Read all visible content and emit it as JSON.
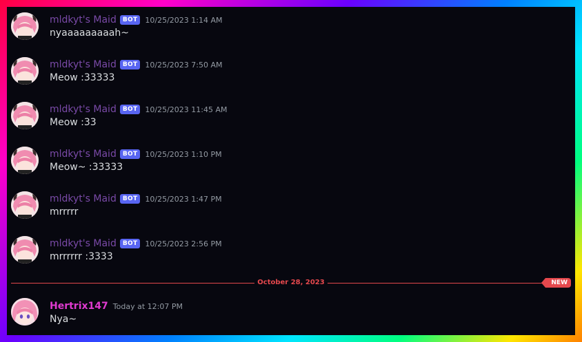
{
  "messages": [
    {
      "author": "mldkyt's Maid",
      "badge": "BOT",
      "timestamp": "10/25/2023 1:14 AM",
      "text": "nyaaaaaaaaah~"
    },
    {
      "author": "mldkyt's Maid",
      "badge": "BOT",
      "timestamp": "10/25/2023 7:50 AM",
      "text": "Meow :33333"
    },
    {
      "author": "mldkyt's Maid",
      "badge": "BOT",
      "timestamp": "10/25/2023 11:45 AM",
      "text": "Meow :33"
    },
    {
      "author": "mldkyt's Maid",
      "badge": "BOT",
      "timestamp": "10/25/2023 1:10 PM",
      "text": "Meow~ :33333"
    },
    {
      "author": "mldkyt's Maid",
      "badge": "BOT",
      "timestamp": "10/25/2023 1:47 PM",
      "text": "mrrrrr"
    },
    {
      "author": "mldkyt's Maid",
      "badge": "BOT",
      "timestamp": "10/25/2023 2:56 PM",
      "text": "mrrrrrr :3333"
    }
  ],
  "divider": {
    "date": "October 28, 2023",
    "new_label": "NEW"
  },
  "last_message": {
    "author": "Hertrix147",
    "timestamp": "Today at 12:07 PM",
    "text": "Nya~"
  },
  "colors": {
    "bot_name": "#7a4aa8",
    "user_name": "#e03ad0",
    "bot_badge": "#5865f2",
    "new_divider": "#e5484d"
  }
}
